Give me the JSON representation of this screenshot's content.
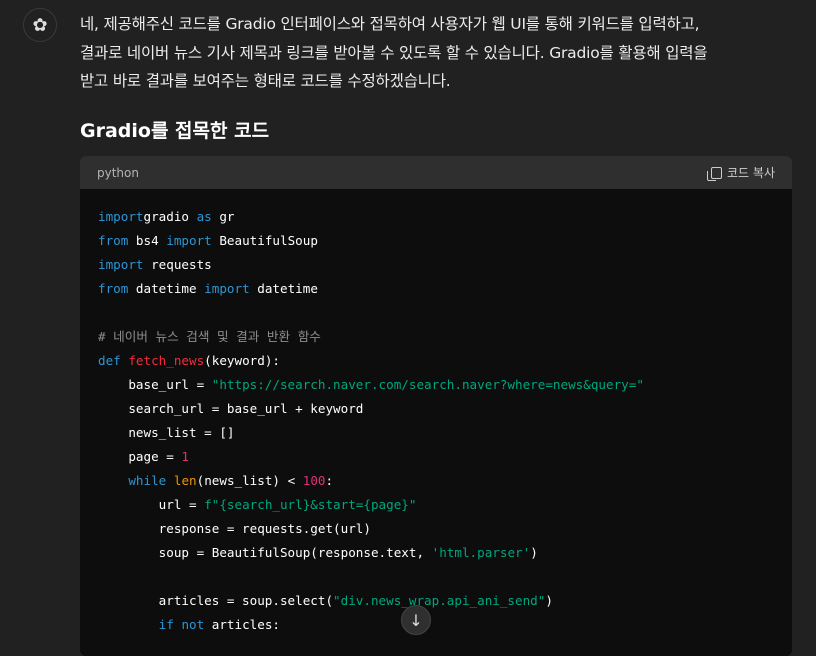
{
  "assistant": {
    "avatar_icon": "openai-logo-icon",
    "message_lines": [
      "네, 제공해주신 코드를 Gradio 인터페이스와 접목하여 사용자가 웹 UI를 통해 키워드를 입력하고,",
      "결과로 네이버 뉴스 기사 제목과 링크를 받아볼 수 있도록 할 수 있습니다. Gradio를 활용해 입력을",
      "받고 바로 결과를 보여주는 형태로 코드를 수정하겠습니다."
    ],
    "heading": "Gradio를 접목한 코드"
  },
  "codeblock": {
    "language": "python",
    "copy_label": "코드 복사",
    "lines": [
      [
        [
          "kw",
          "import"
        ],
        [
          "",
          "gradio "
        ],
        [
          "kw",
          "as"
        ],
        [
          "",
          " gr"
        ]
      ],
      [
        [
          "kw",
          "from"
        ],
        [
          "",
          " bs4 "
        ],
        [
          "kw",
          "import"
        ],
        [
          "",
          " BeautifulSoup"
        ]
      ],
      [
        [
          "kw",
          "import"
        ],
        [
          "",
          " requests"
        ]
      ],
      [
        [
          "kw",
          "from"
        ],
        [
          "",
          " datetime "
        ],
        [
          "kw",
          "import"
        ],
        [
          "",
          " datetime"
        ]
      ],
      [],
      [
        [
          "cm",
          "# 네이버 뉴스 검색 및 결과 반환 함수"
        ]
      ],
      [
        [
          "kw",
          "def"
        ],
        [
          "",
          " "
        ],
        [
          "fn",
          "fetch_news"
        ],
        [
          "",
          "(keyword):"
        ]
      ],
      [
        [
          "",
          "    base_url = "
        ],
        [
          "str",
          "\"https://search.naver.com/search.naver?where=news&query=\""
        ]
      ],
      [
        [
          "",
          "    search_url = base_url + keyword"
        ]
      ],
      [
        [
          "",
          "    news_list = []"
        ]
      ],
      [
        [
          "",
          "    page = "
        ],
        [
          "num",
          "1"
        ]
      ],
      [
        [
          "",
          "    "
        ],
        [
          "kw",
          "while"
        ],
        [
          "",
          " "
        ],
        [
          "bi",
          "len"
        ],
        [
          "",
          "(news_list) < "
        ],
        [
          "num",
          "100"
        ],
        [
          "",
          ":"
        ]
      ],
      [
        [
          "",
          "        url = "
        ],
        [
          "str",
          "f\"{search_url}&start={page}\""
        ]
      ],
      [
        [
          "",
          "        response = requests.get(url)"
        ]
      ],
      [
        [
          "",
          "        soup = BeautifulSoup(response.text, "
        ],
        [
          "str",
          "'html.parser'"
        ],
        [
          "",
          ")"
        ]
      ],
      [],
      [
        [
          "",
          "        articles = soup.select("
        ],
        [
          "str",
          "\"div.news_wrap.api_ani_send\""
        ],
        [
          "",
          ")"
        ]
      ],
      [
        [
          "",
          "        "
        ],
        [
          "kw",
          "if"
        ],
        [
          "",
          " "
        ],
        [
          "kw",
          "not"
        ],
        [
          "",
          " articles:"
        ]
      ]
    ]
  },
  "scroll_button_icon": "arrow-down-icon"
}
